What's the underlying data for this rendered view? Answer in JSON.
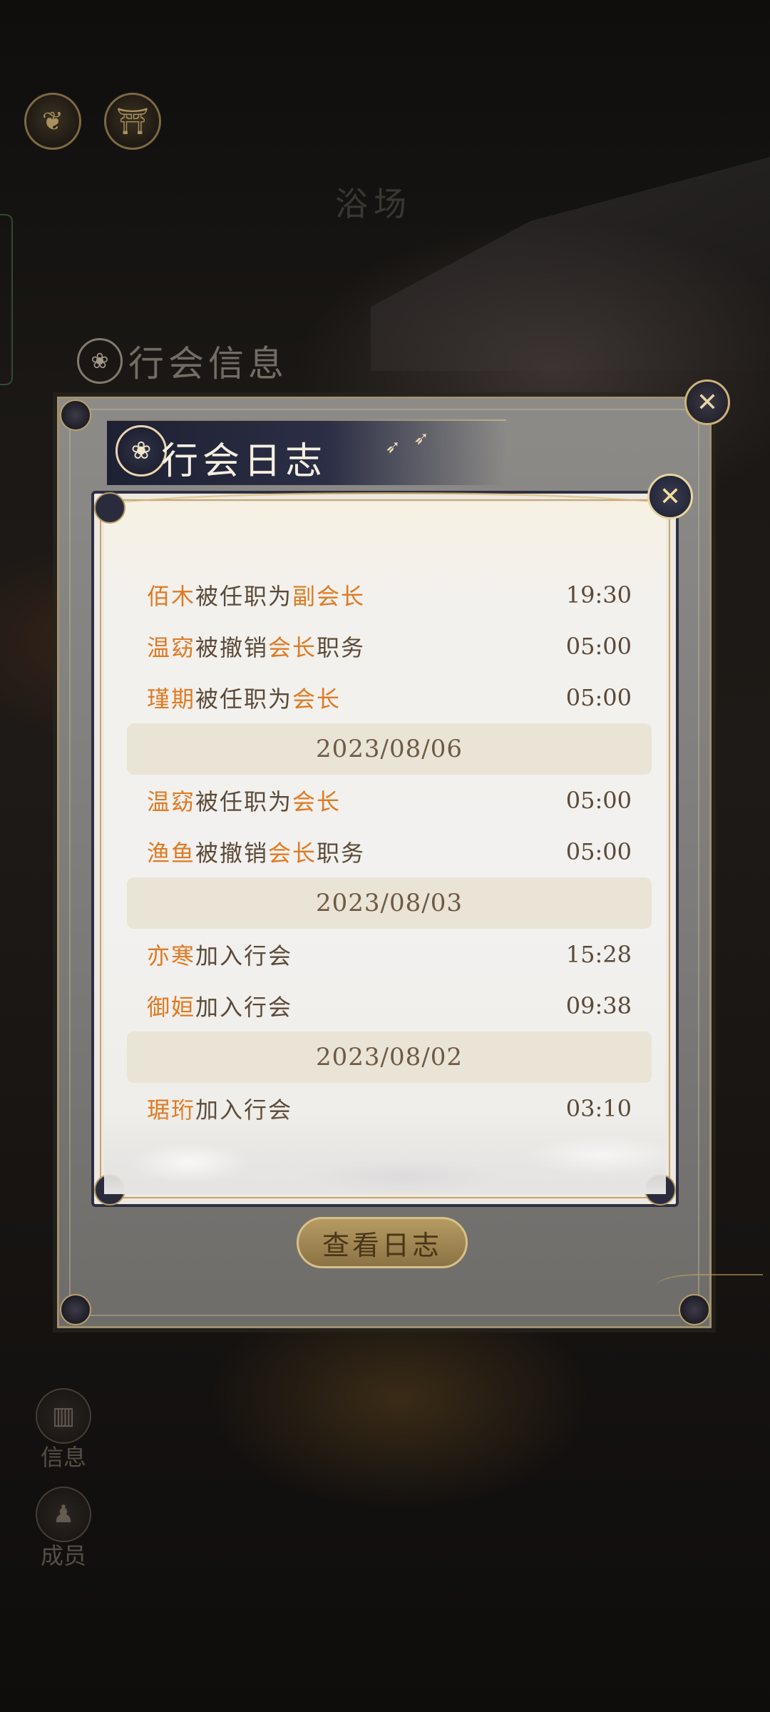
{
  "background": {
    "location_label": "浴场",
    "panel_title": "行会信息",
    "side_nav": [
      {
        "label": "信息",
        "icon": "building-icon"
      },
      {
        "label": "成员",
        "icon": "member-icon"
      }
    ],
    "top_icons": [
      "leaf-emblem-icon",
      "pavilion-icon"
    ],
    "view_log_button": "查看日志"
  },
  "dialog": {
    "title": "行会日志",
    "close_icon": "close-icon",
    "entries": [
      {
        "type": "log",
        "segments": [
          {
            "text": "佰木",
            "hl": true
          },
          {
            "text": "被任职为",
            "hl": false
          },
          {
            "text": "副会长",
            "hl": true
          }
        ],
        "time": "19:30"
      },
      {
        "type": "log",
        "segments": [
          {
            "text": "温窈",
            "hl": true
          },
          {
            "text": "被撤销",
            "hl": false
          },
          {
            "text": "会长",
            "hl": true
          },
          {
            "text": "职务",
            "hl": false
          }
        ],
        "time": "05:00"
      },
      {
        "type": "log",
        "segments": [
          {
            "text": "瑾期",
            "hl": true
          },
          {
            "text": "被任职为",
            "hl": false
          },
          {
            "text": "会长",
            "hl": true
          }
        ],
        "time": "05:00"
      },
      {
        "type": "date",
        "label": "2023/08/06"
      },
      {
        "type": "log",
        "segments": [
          {
            "text": "温窈",
            "hl": true
          },
          {
            "text": "被任职为",
            "hl": false
          },
          {
            "text": "会长",
            "hl": true
          }
        ],
        "time": "05:00"
      },
      {
        "type": "log",
        "segments": [
          {
            "text": "渔鱼",
            "hl": true
          },
          {
            "text": "被撤销",
            "hl": false
          },
          {
            "text": "会长",
            "hl": true
          },
          {
            "text": "职务",
            "hl": false
          }
        ],
        "time": "05:00"
      },
      {
        "type": "date",
        "label": "2023/08/03"
      },
      {
        "type": "log",
        "segments": [
          {
            "text": "亦寒",
            "hl": true
          },
          {
            "text": "加入行会",
            "hl": false
          }
        ],
        "time": "15:28"
      },
      {
        "type": "log",
        "segments": [
          {
            "text": "御姮",
            "hl": true
          },
          {
            "text": "加入行会",
            "hl": false
          }
        ],
        "time": "09:38"
      },
      {
        "type": "date",
        "label": "2023/08/02"
      },
      {
        "type": "log",
        "segments": [
          {
            "text": "琚珩",
            "hl": true
          },
          {
            "text": "加入行会",
            "hl": false
          }
        ],
        "time": "03:10"
      }
    ]
  },
  "colors": {
    "highlight": "#e07a22",
    "text": "#5b4a38",
    "date_band": "#e9e4d6",
    "frame_dark": "#2d2f42",
    "gold": "#c4a56a"
  }
}
